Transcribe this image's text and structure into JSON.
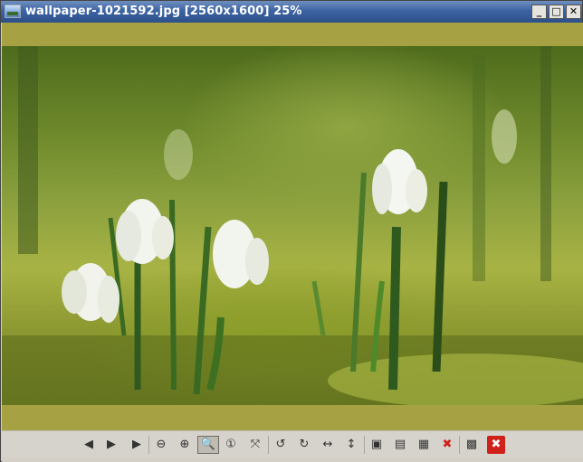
{
  "window": {
    "title": "wallpaper-1021592.jpg [2560x1600] 25%",
    "controls": {
      "minimize": "_",
      "maximize": "□",
      "close": "✕"
    }
  },
  "image": {
    "description_icon": "photo-icon"
  },
  "toolbar": {
    "buttons": [
      {
        "name": "previous-image-button",
        "icon": "arrow-left-icon",
        "glyph": "◀"
      },
      {
        "name": "next-image-button",
        "icon": "arrow-right-icon",
        "glyph": "▶"
      },
      {
        "name": "slideshow-button",
        "icon": "play-icon",
        "glyph": "▶"
      },
      {
        "name": "zoom-out-button",
        "icon": "zoom-out-icon",
        "glyph": "⊖"
      },
      {
        "name": "zoom-in-button",
        "icon": "zoom-in-icon",
        "glyph": "⊕"
      },
      {
        "name": "zoom-fit-button",
        "icon": "magnifier-icon",
        "glyph": "🔍"
      },
      {
        "name": "zoom-original-button",
        "icon": "zoom-100-icon",
        "glyph": "①"
      },
      {
        "name": "fullscreen-button",
        "icon": "fullscreen-icon",
        "glyph": "⤧"
      },
      {
        "name": "rotate-left-button",
        "icon": "rotate-ccw-icon",
        "glyph": "↺"
      },
      {
        "name": "rotate-right-button",
        "icon": "rotate-cw-icon",
        "glyph": "↻"
      },
      {
        "name": "flip-horizontal-button",
        "icon": "flip-horizontal-icon",
        "glyph": "↔"
      },
      {
        "name": "flip-vertical-button",
        "icon": "flip-vertical-icon",
        "glyph": "↕"
      },
      {
        "name": "open-file-button",
        "icon": "open-folder-icon",
        "glyph": "▣"
      },
      {
        "name": "save-file-button",
        "icon": "save-icon",
        "glyph": "▤"
      },
      {
        "name": "save-as-button",
        "icon": "save-as-icon",
        "glyph": "▦"
      },
      {
        "name": "delete-file-button",
        "icon": "delete-icon",
        "glyph": "✖"
      },
      {
        "name": "preferences-button",
        "icon": "preferences-icon",
        "glyph": "▩"
      },
      {
        "name": "quit-button",
        "icon": "quit-icon",
        "glyph": "✖"
      }
    ]
  },
  "colors": {
    "titlebar": "#3d64a2",
    "viewer_bg": "#a6a142",
    "delete": "#d0201a",
    "quit": "#d0201a"
  }
}
